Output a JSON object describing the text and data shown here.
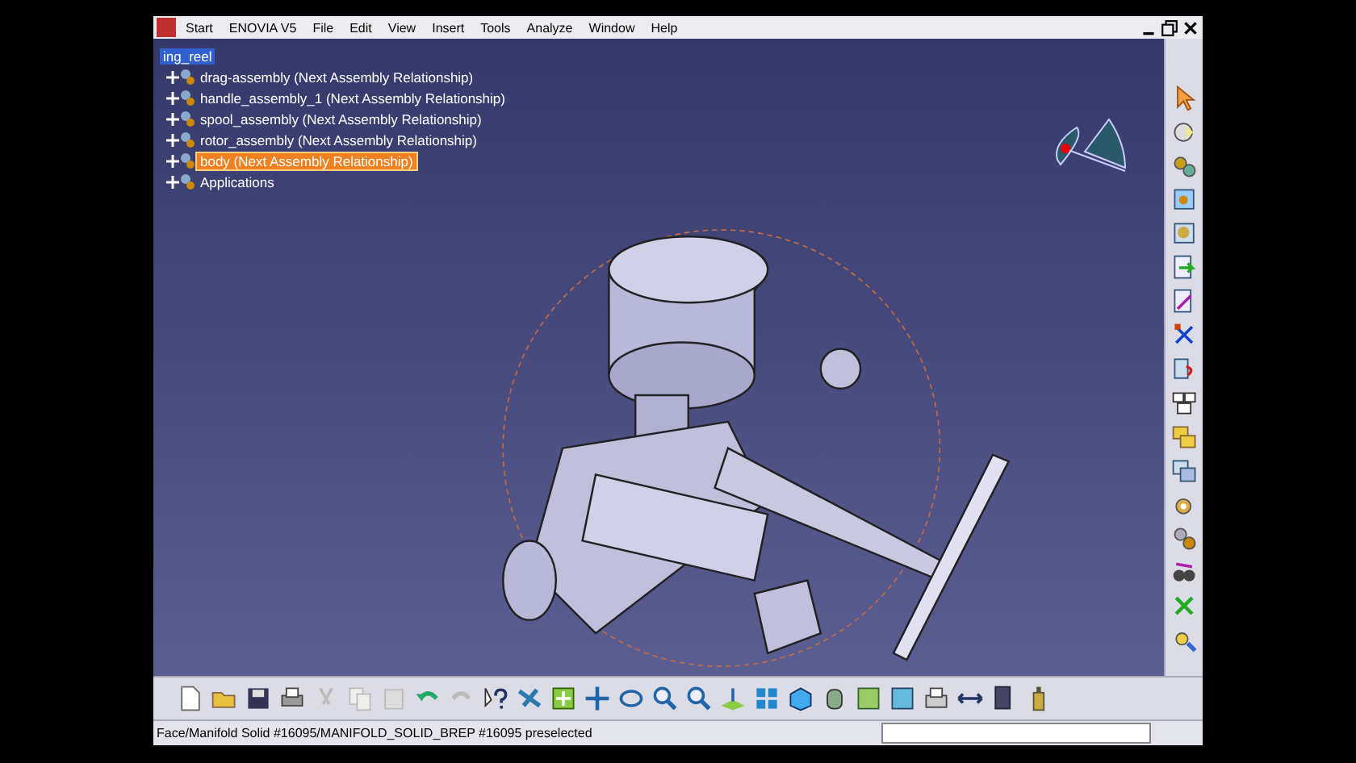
{
  "menu": [
    {
      "label": "Start"
    },
    {
      "label": "ENOVIA V5"
    },
    {
      "label": "File"
    },
    {
      "label": "Edit"
    },
    {
      "label": "View"
    },
    {
      "label": "Insert"
    },
    {
      "label": "Tools"
    },
    {
      "label": "Analyze"
    },
    {
      "label": "Window"
    },
    {
      "label": "Help"
    }
  ],
  "tree": {
    "label": "ing_reel",
    "selected": true,
    "preselected": false,
    "children": [
      {
        "label": "drag-assembly (Next Assembly Relationship)",
        "selected": false,
        "preselected": false
      },
      {
        "label": "handle_assembly_1 (Next Assembly Relationship)",
        "selected": false,
        "preselected": false
      },
      {
        "label": "spool_assembly (Next Assembly Relationship)",
        "selected": false,
        "preselected": false
      },
      {
        "label": "rotor_assembly (Next Assembly Relationship)",
        "selected": false,
        "preselected": false
      },
      {
        "label": "body (Next Assembly Relationship)",
        "selected": false,
        "preselected": true
      },
      {
        "label": "Applications",
        "selected": false,
        "preselected": false
      }
    ]
  },
  "status_bar": {
    "message": "Face/Manifold Solid #16095/MANIFOLD_SOLID_BREP #16095 preselected"
  }
}
